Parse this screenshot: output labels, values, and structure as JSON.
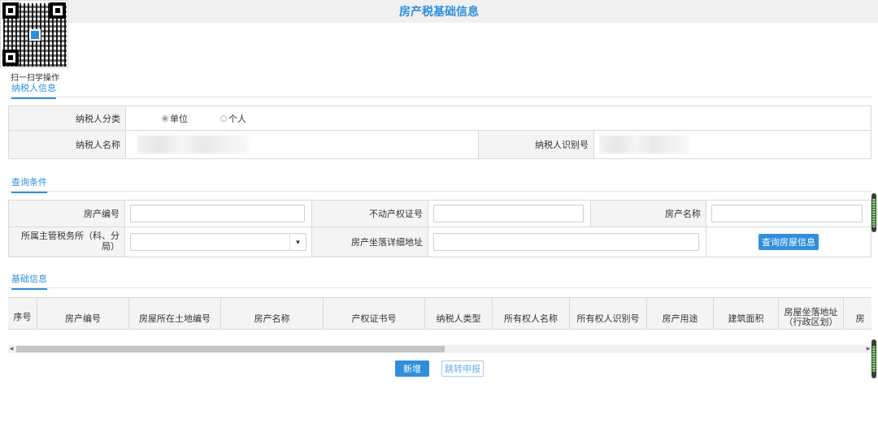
{
  "page": {
    "title": "房产税基础信息"
  },
  "qr": {
    "caption": "扫一扫学操作"
  },
  "taxpayer_section": {
    "tab_label": "纳税人信息",
    "category_label": "纳税人分类",
    "category_options": [
      {
        "label": "单位",
        "selected": true
      },
      {
        "label": "个人",
        "selected": false
      }
    ],
    "name_label": "纳税人名称",
    "id_label": "纳税人识别号"
  },
  "query_section": {
    "tab_label": "查询条件",
    "property_no_label": "房产编号",
    "cert_no_label": "不动产权证号",
    "property_name_label": "房产名称",
    "tax_office_label": "所属主管税务所（科、分局）",
    "address_label": "房产坐落详细地址",
    "query_button": "查询房屋信息"
  },
  "basic_section": {
    "tab_label": "基础信息",
    "columns": [
      "序号",
      "房产编号",
      "房屋所在土地编号",
      "房产名称",
      "产权证书号",
      "纳税人类型",
      "所有权人名称",
      "所有权人识别号",
      "房产用途",
      "建筑面积",
      "房屋坐落地址（行政区划）",
      "房"
    ]
  },
  "actions": {
    "add_button": "新增",
    "jump_button": "跳转申报"
  },
  "colors": {
    "accent": "#2f8fdd",
    "label_bg": "#f4f4f4",
    "border": "#d9d9d9"
  }
}
